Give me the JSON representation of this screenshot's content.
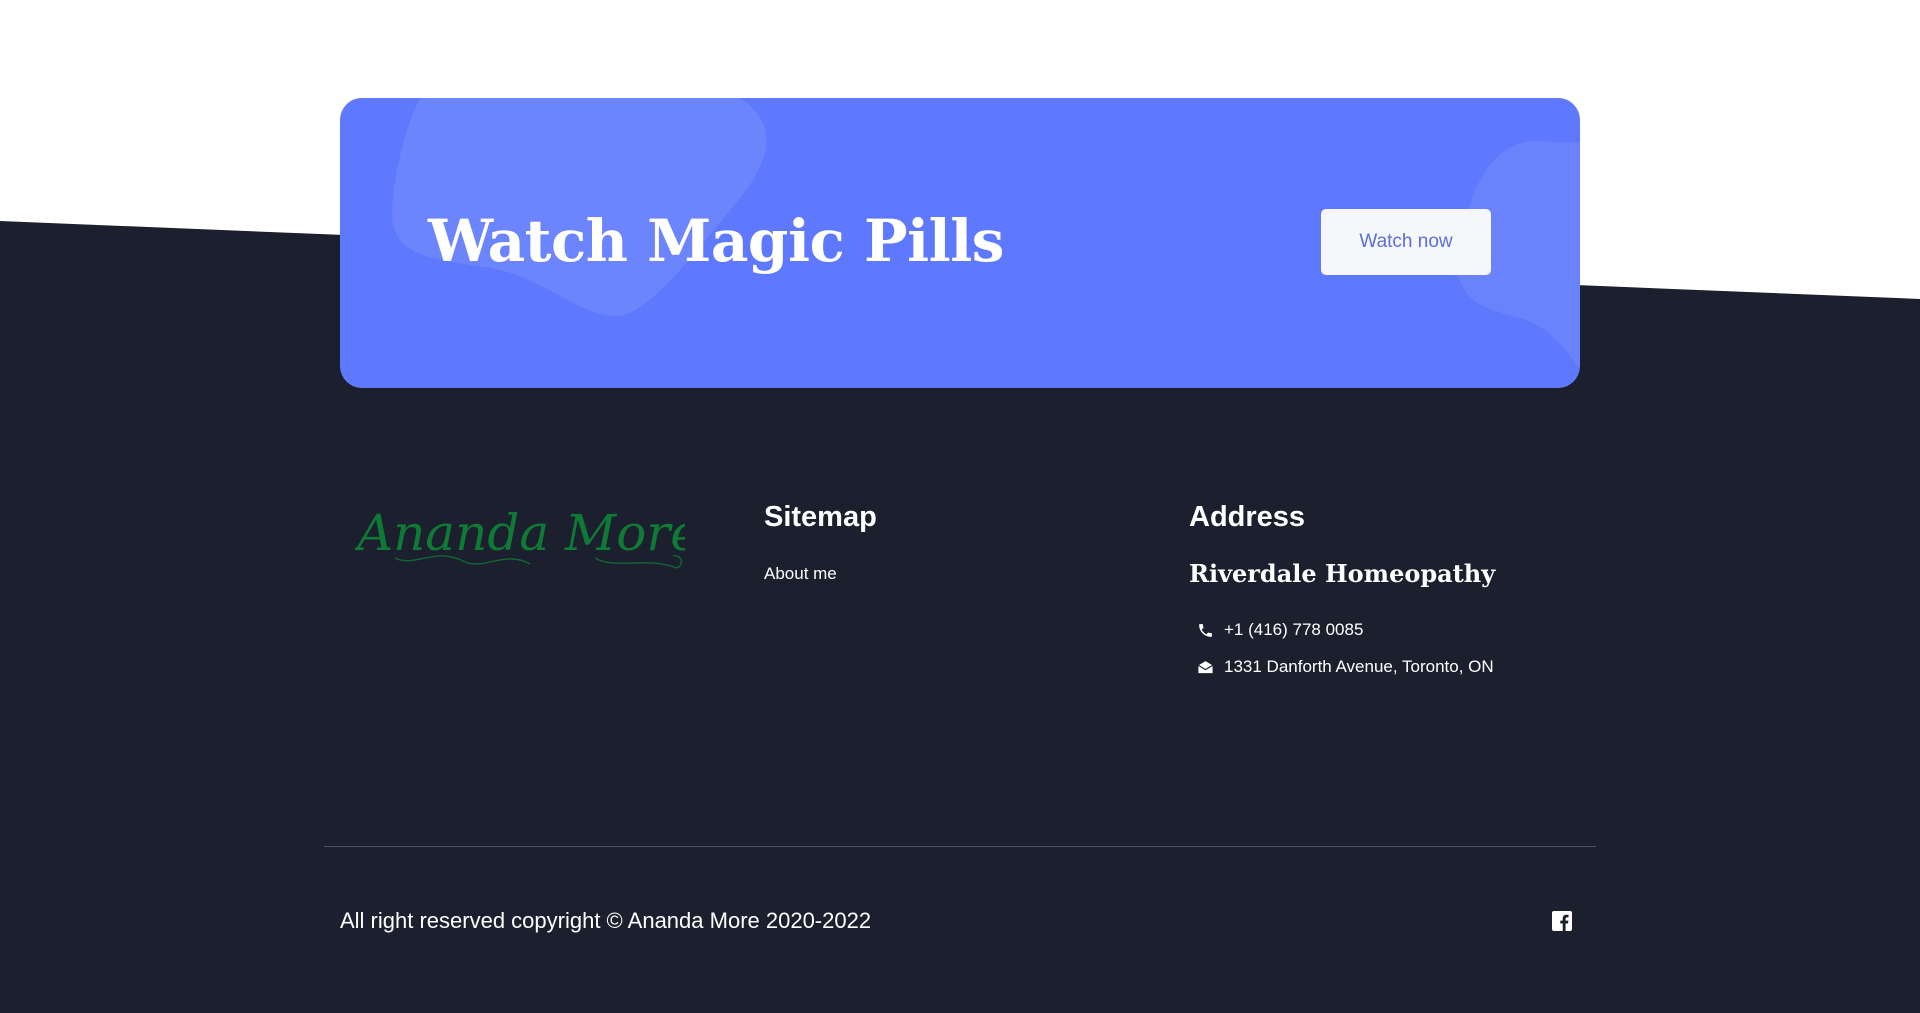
{
  "cta": {
    "title": "Watch Magic Pills",
    "button_label": "Watch now"
  },
  "footer": {
    "logo_text": "Ananda More",
    "sitemap": {
      "heading": "Sitemap",
      "links": [
        "About me"
      ]
    },
    "address": {
      "heading": "Address",
      "business_name": "Riverdale Homeopathy",
      "phone": "+1 (416) 778 0085",
      "street": "1331 Danforth Avenue, Toronto, ON"
    },
    "copyright": "All right reserved copyright © Ananda More 2020-2022",
    "social": [
      "facebook-icon"
    ]
  },
  "colors": {
    "cta_background": "#5e79fd",
    "footer_background": "#1b1f2e",
    "logo_green": "#0f7a35",
    "button_text": "#5a6fd8"
  }
}
